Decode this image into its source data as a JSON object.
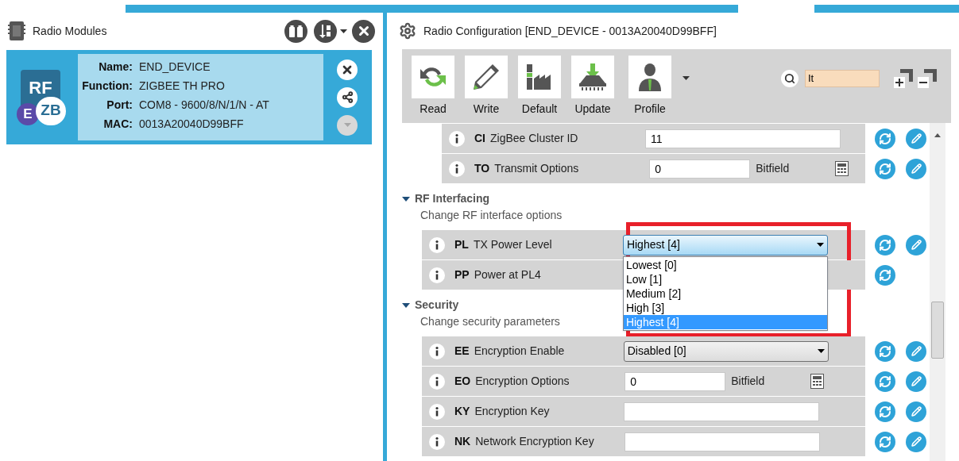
{
  "modules_panel": {
    "title": "Radio Modules",
    "device": {
      "logo": {
        "text": "RF",
        "badge_left": "E",
        "badge_right": "ZB"
      },
      "fields": [
        {
          "label": "Name:",
          "value": "END_DEVICE"
        },
        {
          "label": "Function:",
          "value": "ZIGBEE TH PRO"
        },
        {
          "label": "Port:",
          "value": "COM8 - 9600/8/N/1/N - AT"
        },
        {
          "label": "MAC:",
          "value": "0013A20040D99BFF"
        }
      ],
      "collapse_disabled": true
    }
  },
  "config_panel": {
    "title": "Radio Configuration [END_DEVICE - 0013A20040D99BFF]",
    "toolbar": [
      {
        "label": "Read"
      },
      {
        "label": "Write"
      },
      {
        "label": "Default"
      },
      {
        "label": "Update"
      },
      {
        "label": "Profile"
      }
    ],
    "search": {
      "value": "It"
    },
    "sections": [
      {
        "rows": [
          {
            "kind": "text",
            "code": "CI",
            "label": "ZigBee Cluster ID",
            "value": "11",
            "writable": true
          },
          {
            "kind": "bitfield",
            "code": "TO",
            "label": "Transmit Options",
            "value": "0",
            "unit": "Bitfield",
            "writable": true
          }
        ]
      },
      {
        "title": "RF Interfacing",
        "subtitle": "Change RF interface options",
        "expanded": true,
        "rows": [
          {
            "kind": "select",
            "code": "PL",
            "label": "TX Power Level",
            "value": "Highest [4]",
            "writable": true,
            "open": true,
            "highlighted": true,
            "options": [
              {
                "label": "Lowest [0]",
                "selected": false
              },
              {
                "label": "Low [1]",
                "selected": false
              },
              {
                "label": "Medium [2]",
                "selected": false
              },
              {
                "label": "High [3]",
                "selected": false
              },
              {
                "label": "Highest [4]",
                "selected": true
              }
            ]
          },
          {
            "kind": "readonly",
            "code": "PP",
            "label": "Power at PL4",
            "writable": false
          }
        ]
      },
      {
        "title": "Security",
        "subtitle": "Change security parameters",
        "expanded": true,
        "rows": [
          {
            "kind": "select",
            "code": "EE",
            "label": "Encryption Enable",
            "value": "Disabled [0]",
            "writable": true,
            "open": false
          },
          {
            "kind": "bitfield",
            "code": "EO",
            "label": "Encryption Options",
            "value": "0",
            "unit": "Bitfield",
            "writable": true
          },
          {
            "kind": "text",
            "code": "KY",
            "label": "Encryption Key",
            "writable": true
          },
          {
            "kind": "text",
            "code": "NK",
            "label": "Network Encryption Key",
            "writable": true
          }
        ]
      }
    ]
  }
}
